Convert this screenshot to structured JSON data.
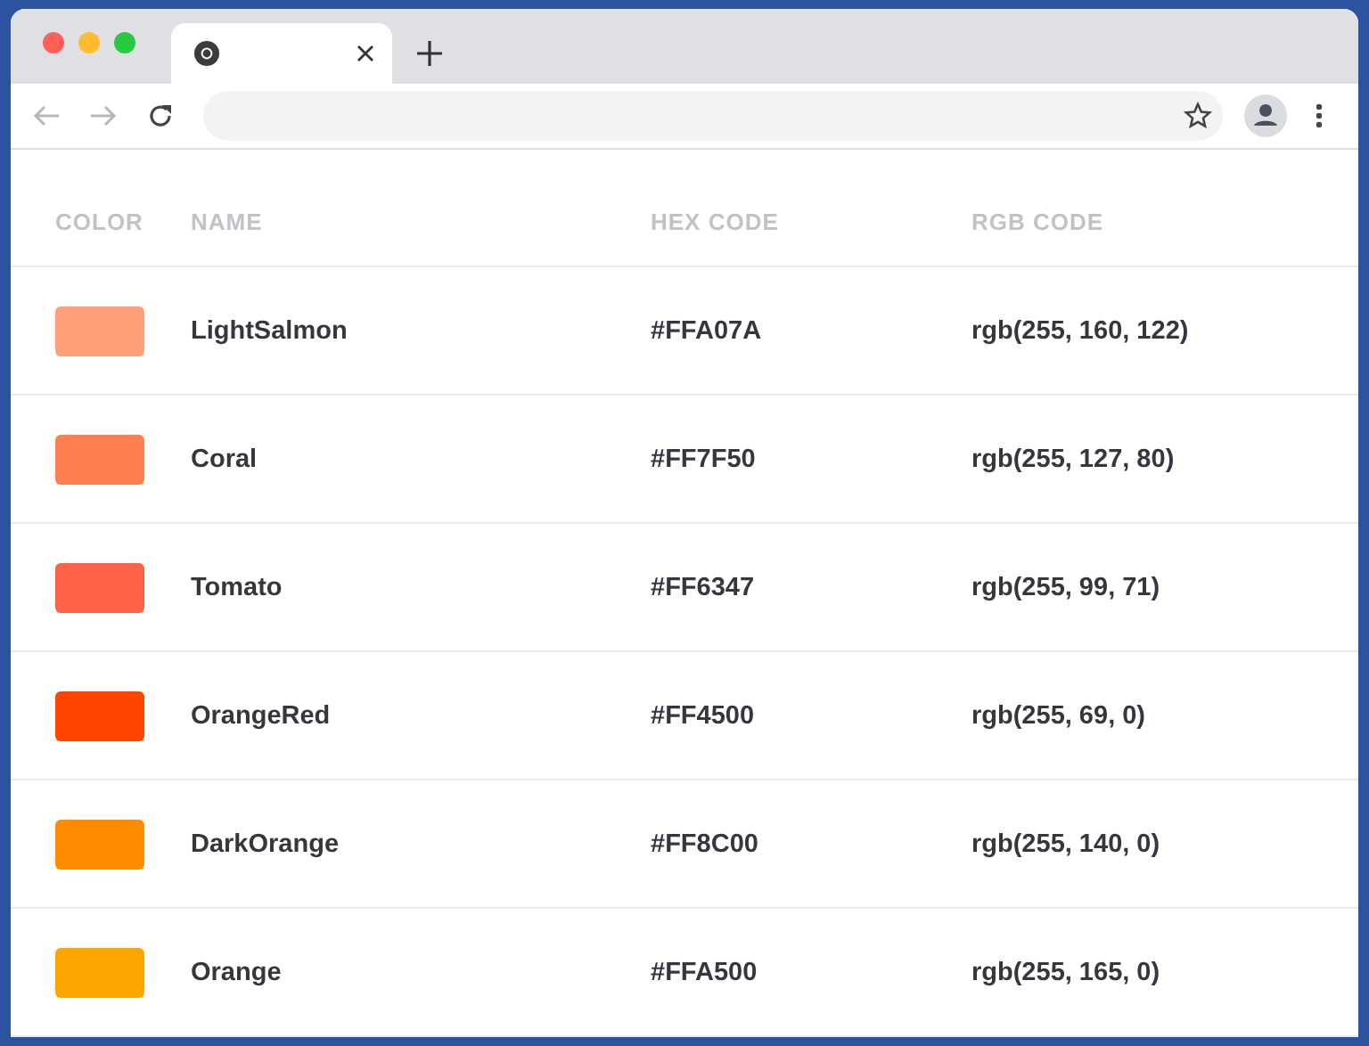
{
  "browser": {
    "tabs": [
      {
        "selected": true
      }
    ],
    "back": {
      "disabled": true
    },
    "forward": {
      "disabled": true
    }
  },
  "table": {
    "columns": [
      "COLOR",
      "NAME",
      "HEX CODE",
      "RGB CODE"
    ],
    "rows": [
      {
        "color": "#ffa07a",
        "name": "LightSalmon",
        "hex": "#FFA07A",
        "rgb": "rgb(255, 160, 122)"
      },
      {
        "color": "#ff7f50",
        "name": "Coral",
        "hex": "#FF7F50",
        "rgb": "rgb(255, 127, 80)"
      },
      {
        "color": "#ff6347",
        "name": "Tomato",
        "hex": "#FF6347",
        "rgb": "rgb(255, 99, 71)"
      },
      {
        "color": "#ff4500",
        "name": "OrangeRed",
        "hex": "#FF4500",
        "rgb": "rgb(255, 69, 0)"
      },
      {
        "color": "#ff8c00",
        "name": "DarkOrange",
        "hex": "#FF8C00",
        "rgb": "rgb(255, 140, 0)"
      },
      {
        "color": "#ffa500",
        "name": "Orange",
        "hex": "#FFA500",
        "rgb": "rgb(255, 165, 0)"
      }
    ]
  }
}
